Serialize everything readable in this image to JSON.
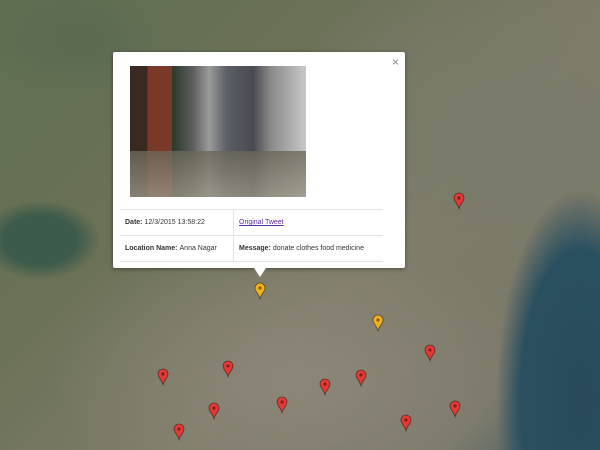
{
  "popup": {
    "close_label": "×",
    "date_label": "Date:",
    "date_value": "12/3/2015 13:58:22",
    "tweet_link": "Original Tweet",
    "location_label": "Location Name:",
    "location_value": "Anna Nagar",
    "message_label": "Message:",
    "message_value": "donate clothes food medicine"
  },
  "markers": [
    {
      "color": "#e53935",
      "type": "red"
    },
    {
      "color": "#f2b01e",
      "type": "yellow"
    },
    {
      "color": "#f2b01e",
      "type": "yellow"
    },
    {
      "color": "#e53935",
      "type": "red"
    },
    {
      "color": "#e53935",
      "type": "red"
    },
    {
      "color": "#e53935",
      "type": "red"
    },
    {
      "color": "#e53935",
      "type": "red"
    },
    {
      "color": "#e53935",
      "type": "red"
    },
    {
      "color": "#e53935",
      "type": "red"
    },
    {
      "color": "#e53935",
      "type": "red"
    },
    {
      "color": "#e53935",
      "type": "red"
    },
    {
      "color": "#e53935",
      "type": "red"
    },
    {
      "color": "#e53935",
      "type": "red"
    }
  ]
}
